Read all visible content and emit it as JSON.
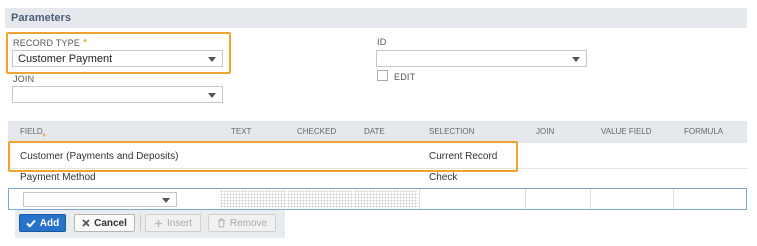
{
  "section": {
    "title": "Parameters"
  },
  "form": {
    "record_type": {
      "label": "RECORD TYPE",
      "required_mark": "*",
      "value": "Customer Payment"
    },
    "join": {
      "label": "JOIN",
      "value": ""
    },
    "id": {
      "label": "ID",
      "value": ""
    },
    "edit": {
      "label": "EDIT",
      "checked": false
    }
  },
  "table": {
    "columns": [
      "FIELD",
      "TEXT",
      "CHECKED",
      "DATE",
      "SELECTION",
      "JOIN",
      "VALUE FIELD",
      "FORMULA"
    ],
    "required_mark": "*",
    "rows": [
      {
        "field": "Customer (Payments and Deposits)",
        "text": "",
        "checked": "",
        "date": "",
        "selection": "Current Record",
        "join": "",
        "value_field": "",
        "formula": ""
      },
      {
        "field": "Payment Method",
        "text": "",
        "checked": "",
        "date": "",
        "selection": "Check",
        "join": "",
        "value_field": "",
        "formula": ""
      }
    ],
    "edit_row": {
      "field_value": ""
    }
  },
  "buttons": {
    "add": "Add",
    "cancel": "Cancel",
    "insert": "Insert",
    "remove": "Remove"
  },
  "colors": {
    "highlight": "#f0a330",
    "primary": "#2673c9",
    "header_bg": "#e5e9ee"
  }
}
